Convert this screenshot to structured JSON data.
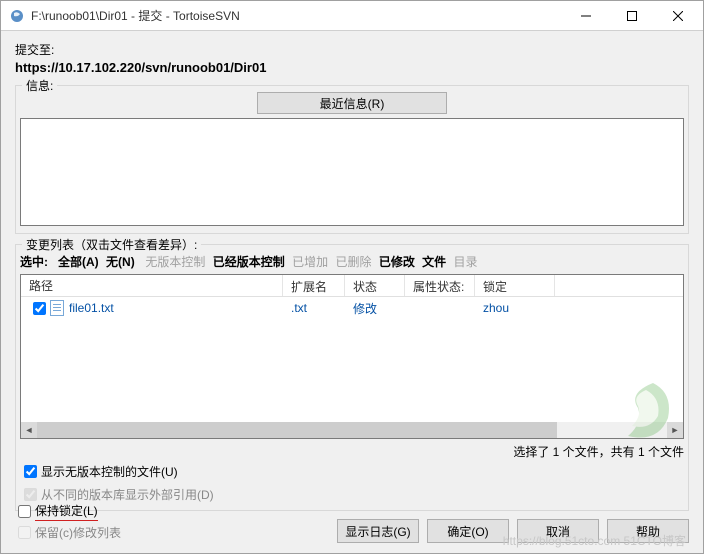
{
  "window": {
    "title": "F:\\runoob01\\Dir01 - 提交 - TortoiseSVN"
  },
  "commit_to_label": "提交至:",
  "commit_url": "https://10.17.102.220/svn/runoob01/Dir01",
  "message": {
    "label": "信息:",
    "recent_button": "最近信息(R)",
    "value": ""
  },
  "changes": {
    "label": "变更列表（双击文件查看差异）:",
    "select_label": "选中:",
    "filters": {
      "all": "全部(A)",
      "none": "无(N)",
      "unversioned": "无版本控制",
      "versioned": "已经版本控制",
      "added": "已增加",
      "deleted": "已删除",
      "modified": "已修改",
      "files": "文件",
      "dirs": "目录"
    },
    "columns": {
      "path": "路径",
      "ext": "扩展名",
      "status": "状态",
      "prop": "属性状态:",
      "lock": "锁定"
    },
    "rows": [
      {
        "path": "file01.txt",
        "ext": ".txt",
        "status": "修改",
        "prop": "",
        "lock": "zhou",
        "checked": true
      }
    ],
    "summary": "选择了 1 个文件，共有 1 个文件"
  },
  "options": {
    "show_unversioned": "显示无版本控制的文件(U)",
    "show_externals": "从不同的版本库显示外部引用(D)",
    "keep_locks": "保持锁定(L)",
    "keep_changelist": "保留(c)修改列表"
  },
  "buttons": {
    "showlog": "显示日志(G)",
    "ok": "确定(O)",
    "cancel": "取消",
    "help": "帮助"
  },
  "watermark_text": "https://blog.51cto.com 51CTO博客"
}
